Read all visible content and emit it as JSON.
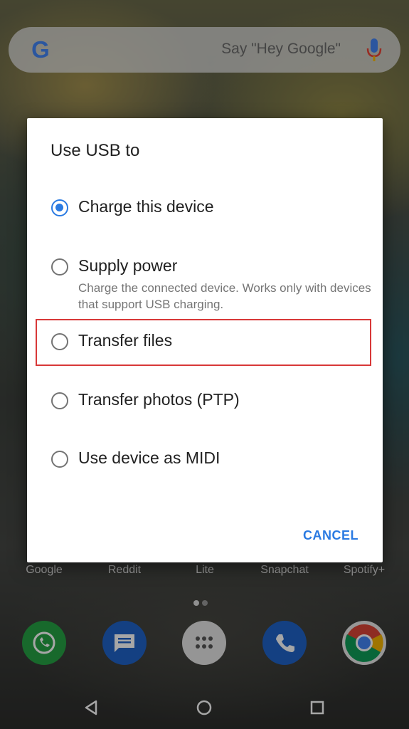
{
  "search": {
    "hint": "Say \"Hey Google\"",
    "logo": "G"
  },
  "apps": [
    {
      "label": "Google"
    },
    {
      "label": "Reddit"
    },
    {
      "label": "Lite"
    },
    {
      "label": "Snapchat"
    },
    {
      "label": "Spotify+"
    }
  ],
  "dock": [
    {
      "icon": "whatsapp-icon",
      "color": "#25a244"
    },
    {
      "icon": "messages-icon",
      "color": "#1f63c8"
    },
    {
      "icon": "app-drawer-icon",
      "color": "#e5e5e5"
    },
    {
      "icon": "phone-icon",
      "color": "#1f63c8"
    },
    {
      "icon": "chrome-icon",
      "color": "#e9e9e9"
    }
  ],
  "dialog": {
    "title": "Use USB to",
    "options": [
      {
        "label": "Charge this device",
        "checked": true
      },
      {
        "label": "Supply power",
        "description": "Charge the connected device. Works only with devices that support USB charging.",
        "checked": false
      },
      {
        "label": "Transfer files",
        "checked": false,
        "highlighted": true
      },
      {
        "label": "Transfer photos (PTP)",
        "checked": false
      },
      {
        "label": "Use device as MIDI",
        "checked": false
      }
    ],
    "cancel_label": "CANCEL"
  },
  "colors": {
    "accent": "#2a7ae2",
    "highlight": "#d83838"
  }
}
